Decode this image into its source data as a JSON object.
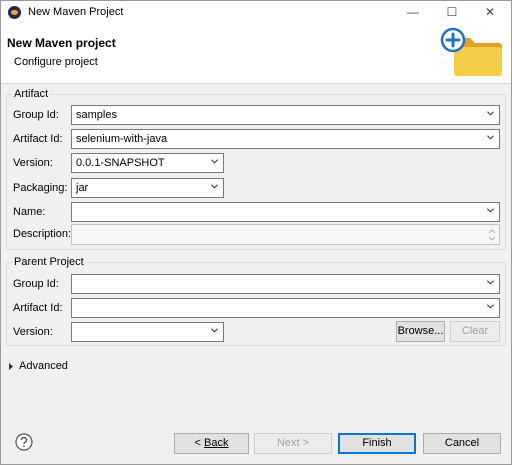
{
  "window": {
    "title": "New Maven Project",
    "minimize_glyph": "—",
    "maximize_glyph": "☐",
    "close_glyph": "✕"
  },
  "header": {
    "title": "New Maven project",
    "subtitle": "Configure project",
    "banner_icon": "folder-add-icon"
  },
  "artifact": {
    "group_label": "Artifact",
    "group_id": {
      "label": "Group Id:",
      "value": "samples"
    },
    "artifact_id": {
      "label": "Artifact Id:",
      "value": "selenium-with-java"
    },
    "version": {
      "label": "Version:",
      "value": "0.0.1-SNAPSHOT"
    },
    "packaging": {
      "label": "Packaging:",
      "value": "jar"
    },
    "name": {
      "label": "Name:",
      "value": ""
    },
    "description": {
      "label": "Description:",
      "value": ""
    }
  },
  "parent": {
    "group_label": "Parent Project",
    "group_id": {
      "label": "Group Id:",
      "value": ""
    },
    "artifact_id": {
      "label": "Artifact Id:",
      "value": ""
    },
    "version": {
      "label": "Version:",
      "value": ""
    },
    "browse_label": "Browse...",
    "clear_label": "Clear"
  },
  "advanced": {
    "label": "Advanced"
  },
  "footer": {
    "help_icon": "help-icon",
    "back_label": "Back",
    "next_label": "Next",
    "finish_label": "Finish",
    "cancel_label": "Cancel"
  },
  "colors": {
    "accent": "#0078d7",
    "folder": "#f2c23a",
    "plus": "#1e73c8"
  }
}
